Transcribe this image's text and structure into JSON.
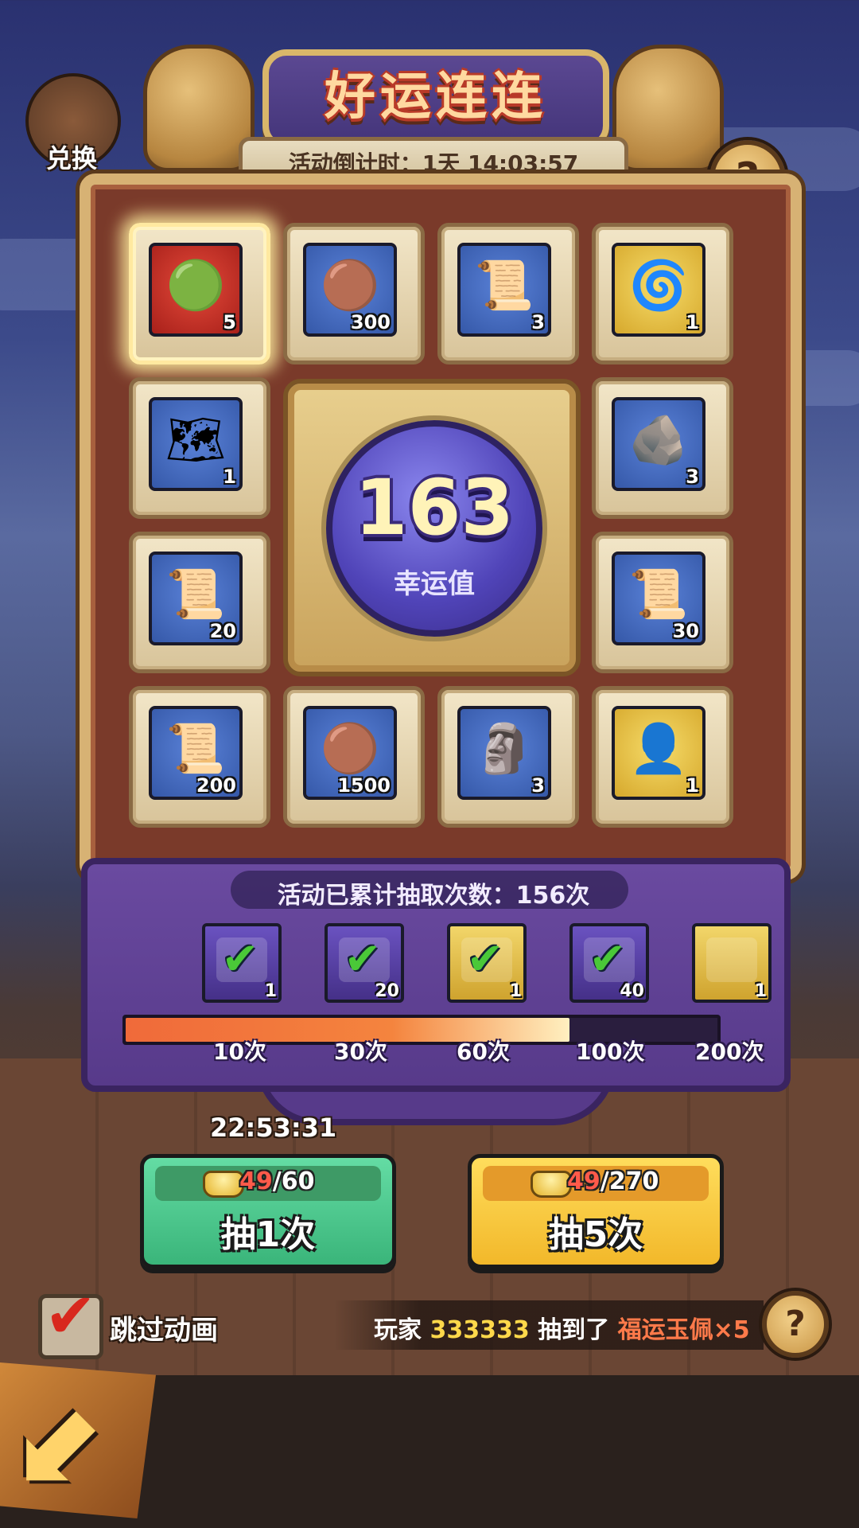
{
  "header": {
    "title": "好运连连",
    "countdown_text": "活动倒计时：1天 14:03:57",
    "exchange_label": "兑换"
  },
  "board": {
    "items": [
      {
        "icon": "jade-pendant-icon",
        "glyph": "🟢",
        "tile": "red",
        "qty": "5",
        "selected": true
      },
      {
        "icon": "copper-coin-icon",
        "glyph": "🟤",
        "tile": "blue",
        "qty": "300"
      },
      {
        "icon": "mystery-scroll-icon",
        "glyph": "📜",
        "tile": "blue",
        "qty": "3"
      },
      {
        "icon": "purple-chest-icon",
        "glyph": "🌀",
        "tile": "gold",
        "qty": "1"
      },
      {
        "icon": "gate-map-icon",
        "glyph": "🗺",
        "tile": "blue",
        "qty": "1"
      },
      {
        "icon": "stone-blocks-icon",
        "glyph": "🪨",
        "tile": "blue",
        "qty": "3"
      },
      {
        "icon": "mystery-scroll-icon",
        "glyph": "📜",
        "tile": "blue",
        "qty": "20"
      },
      {
        "icon": "silver-scroll-icon",
        "glyph": "📜",
        "tile": "blue",
        "qty": "30"
      },
      {
        "icon": "silver-scroll-icon",
        "glyph": "📜",
        "tile": "blue",
        "qty": "200"
      },
      {
        "icon": "copper-coin-icon",
        "glyph": "🟤",
        "tile": "blue",
        "qty": "1500"
      },
      {
        "icon": "stone-beast-icon",
        "glyph": "🗿",
        "tile": "blue",
        "qty": "3"
      },
      {
        "icon": "hero-chest-icon",
        "glyph": "👤",
        "tile": "gold",
        "qty": "1"
      }
    ],
    "luck_value": "163",
    "luck_label": "幸运值"
  },
  "progress": {
    "total_text": "活动已累计抽取次数：156次",
    "fill_fraction": 0.75,
    "rewards": [
      {
        "icon": "purple-chest-icon",
        "tile": "purple",
        "qty": "1",
        "claimed": true
      },
      {
        "icon": "bronze-medal-icon",
        "tile": "purple",
        "qty": "20",
        "claimed": true
      },
      {
        "icon": "gold-chest-icon",
        "tile": "gold",
        "qty": "1",
        "claimed": true
      },
      {
        "icon": "bronze-medal-icon",
        "tile": "purple",
        "qty": "40",
        "claimed": true
      },
      {
        "icon": "dragon-hero-icon",
        "tile": "gold",
        "qty": "1",
        "claimed": false
      }
    ],
    "milestones": [
      "10次",
      "30次",
      "60次",
      "100次",
      "200次"
    ]
  },
  "timer": "22:53:31",
  "draw_buttons": [
    {
      "have": "49",
      "need": "/60",
      "label": "抽1次"
    },
    {
      "have": "49",
      "need": "/270",
      "label": "抽5次"
    }
  ],
  "skip": {
    "label": "跳过动画",
    "checked": true
  },
  "ticker": {
    "prefix": "玩家 ",
    "player": "333333",
    "middle": " 抽到了 ",
    "item": "福运玉佩×5"
  },
  "colors": {
    "accent_purple": "#5a3e8e",
    "accent_gold": "#d7b274",
    "board_red": "#7a3a2a",
    "green_button": "#4ac88a",
    "yellow_button": "#f6c83a"
  }
}
